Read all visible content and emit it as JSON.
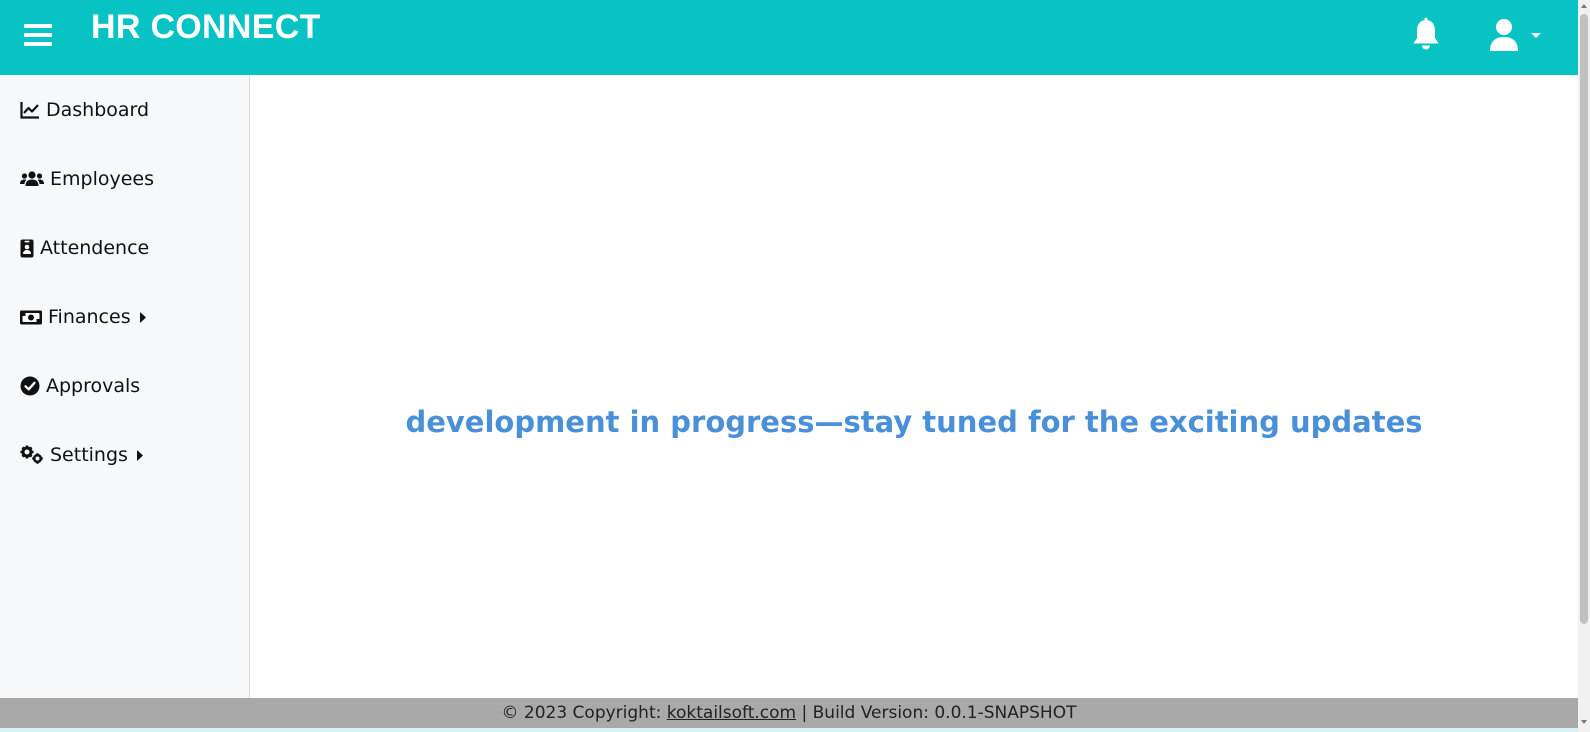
{
  "header": {
    "brand": "HR CONNECT",
    "menu_icon": "hamburger-menu-icon",
    "notification_icon": "bell-icon",
    "user_icon": "user-icon"
  },
  "sidebar": {
    "items": [
      {
        "label": "Dashboard",
        "icon": "chart-line-icon"
      },
      {
        "label": "Employees",
        "icon": "users-icon"
      },
      {
        "label": "Attendence",
        "icon": "id-badge-icon"
      },
      {
        "label": "Finances",
        "icon": "money-bill-icon",
        "has_submenu": true
      },
      {
        "label": "Approvals",
        "icon": "check-circle-icon"
      },
      {
        "label": "Settings",
        "icon": "gears-icon",
        "has_submenu": true
      }
    ]
  },
  "main": {
    "message": "development in progress—stay tuned for the exciting updates"
  },
  "footer": {
    "copyright": "© 2023 Copyright: ",
    "link": "koktailsoft.com",
    "build": " | Build Version: 0.0.1-SNAPSHOT"
  },
  "colors": {
    "header_bg": "#07c3c3",
    "message_text": "#4a90d9",
    "footer_bg": "#a9a9a9",
    "sidebar_bg": "#f7f8fa"
  }
}
